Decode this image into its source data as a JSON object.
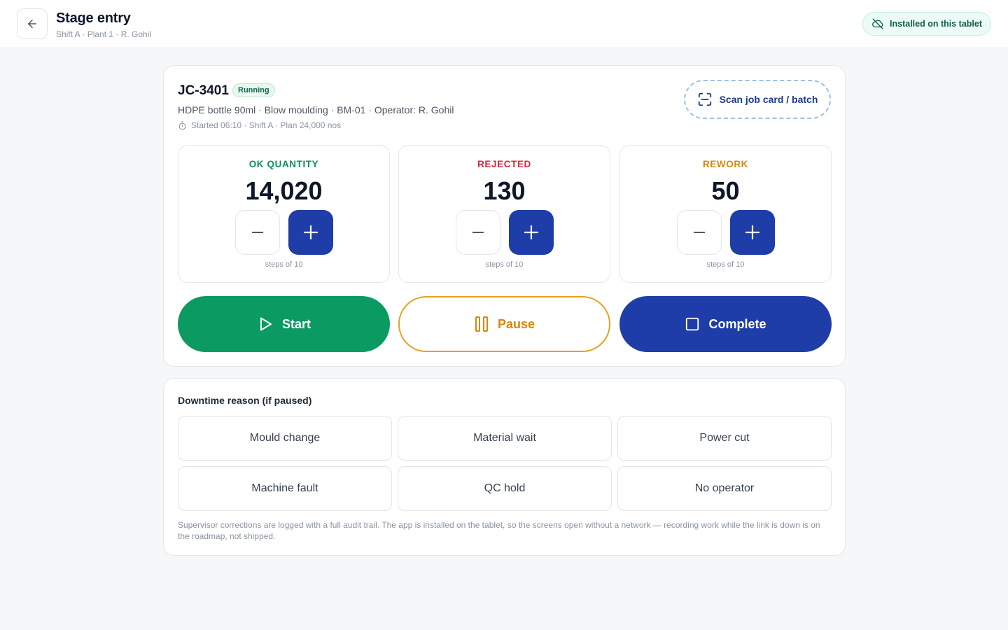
{
  "header": {
    "title": "Stage entry",
    "subtitle": "Shift A · Plant 1 · R. Gohil",
    "installed_label": "Installed on this tablet"
  },
  "job": {
    "id": "JC-3401",
    "status": "Running",
    "description": "HDPE bottle 90ml · Blow moulding · BM-01 · Operator: R. Gohil",
    "meta": "Started 06:10 · Shift A · Plan 24,000 nos",
    "scan_label": "Scan job card / batch"
  },
  "counters": [
    {
      "label": "OK QUANTITY",
      "value": "14,020",
      "note": "steps of 10",
      "color": "#0a8f5b"
    },
    {
      "label": "REJECTED",
      "value": "130",
      "note": "steps of 10",
      "color": "#d6283a"
    },
    {
      "label": "REWORK",
      "value": "50",
      "note": "steps of 10",
      "color": "#d4890a"
    }
  ],
  "actions": {
    "start": "Start",
    "pause": "Pause",
    "complete": "Complete"
  },
  "downtime": {
    "title": "Downtime reason (if paused)",
    "reasons": [
      "Mould change",
      "Material wait",
      "Power cut",
      "Machine fault",
      "QC hold",
      "No operator"
    ],
    "note": "Supervisor corrections are logged with a full audit trail. The app is installed on the tablet, so the screens open without a network — recording work while the link is down is on the roadmap, not shipped."
  },
  "colors": {
    "accent": "#1e3da8",
    "start": "#0a9a62",
    "pause": "#e2a11e"
  }
}
